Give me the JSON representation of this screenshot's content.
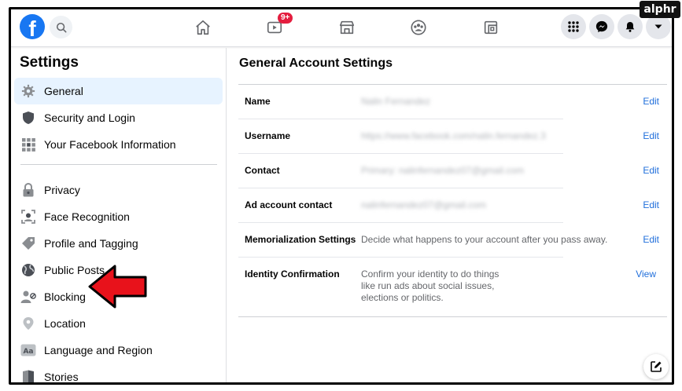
{
  "watermark": "alphr",
  "topbar": {
    "logo_letter": "f",
    "notification_badge": "9+"
  },
  "sidebar": {
    "title": "Settings",
    "items": [
      {
        "label": "General",
        "icon": "gear-icon",
        "active": true
      },
      {
        "label": "Security and Login",
        "icon": "shield-icon"
      },
      {
        "label": "Your Facebook Information",
        "icon": "grid-info-icon"
      },
      {
        "label": "Privacy",
        "icon": "lock-icon"
      },
      {
        "label": "Face Recognition",
        "icon": "face-scan-icon"
      },
      {
        "label": "Profile and Tagging",
        "icon": "tag-icon"
      },
      {
        "label": "Public Posts",
        "icon": "globe-icon"
      },
      {
        "label": "Blocking",
        "icon": "blocked-user-icon"
      },
      {
        "label": "Location",
        "icon": "location-pin-icon"
      },
      {
        "label": "Language and Region",
        "icon": "language-icon"
      },
      {
        "label": "Stories",
        "icon": "book-icon"
      }
    ]
  },
  "main": {
    "title": "General Account Settings",
    "rows": [
      {
        "label": "Name",
        "value": "Nalin Fernandez",
        "action": "Edit",
        "blurred": true
      },
      {
        "label": "Username",
        "value": "https://www.facebook.com/nalin.fernandez.3",
        "action": "Edit",
        "blurred": true
      },
      {
        "label": "Contact",
        "value": "Primary: nalinfernandez07@gmail.com",
        "action": "Edit",
        "blurred": true
      },
      {
        "label": "Ad account contact",
        "value": "nalinfernandez07@gmail.com",
        "action": "Edit",
        "blurred": true
      },
      {
        "label": "Memorialization Settings",
        "value": "Decide what happens to your account after you pass away.",
        "action": "Edit",
        "blurred": false
      },
      {
        "label": "Identity Confirmation",
        "value": "Confirm your identity to do things like run ads about social issues, elections or politics.",
        "action": "View",
        "blurred": false
      }
    ]
  },
  "colors": {
    "brand": "#1877f2",
    "active_bg": "#e7f3ff",
    "link": "#216fdb",
    "badge": "#e41e3f",
    "arrow": "#e8121b"
  }
}
